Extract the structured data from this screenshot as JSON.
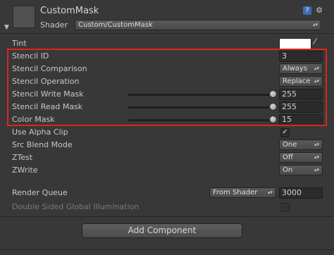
{
  "header": {
    "material_name": "CustomMask",
    "shader_label": "Shader",
    "shader_value": "Custom/CustomMask",
    "icons": [
      "help-icon",
      "settings-icon"
    ]
  },
  "tint": {
    "label": "Tint",
    "color": "#ffffff"
  },
  "stencil": {
    "id": {
      "label": "Stencil ID",
      "value": "3"
    },
    "comparison": {
      "label": "Stencil Comparison",
      "value": "Always"
    },
    "operation": {
      "label": "Stencil Operation",
      "value": "Replace"
    },
    "write_mask": {
      "label": "Stencil Write Mask",
      "value": "255",
      "fraction": 1.0
    },
    "read_mask": {
      "label": "Stencil Read Mask",
      "value": "255",
      "fraction": 1.0
    },
    "color_mask": {
      "label": "Color Mask",
      "value": "15",
      "fraction": 1.0
    }
  },
  "options": {
    "alpha_clip": {
      "label": "Use Alpha Clip",
      "checked": true
    },
    "src_blend": {
      "label": "Src Blend Mode",
      "value": "One"
    },
    "ztest": {
      "label": "ZTest",
      "value": "Off"
    },
    "zwrite": {
      "label": "ZWrite",
      "value": "On"
    }
  },
  "render_queue": {
    "label": "Render Queue",
    "mode": "From Shader",
    "value": "3000"
  },
  "double_sided": {
    "label": "Double Sided Global Illumination",
    "checked": false
  },
  "add_component_label": "Add Component",
  "highlight_color": "#e0231c"
}
